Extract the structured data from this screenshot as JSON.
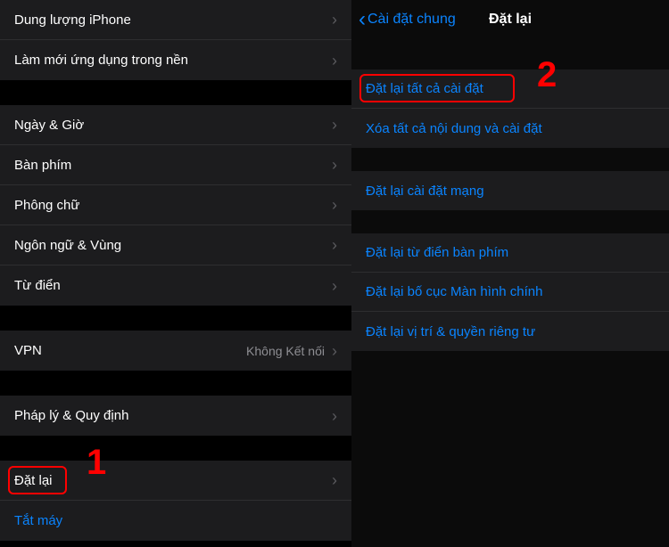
{
  "left": {
    "group1": [
      {
        "label": "Dung lượng iPhone"
      },
      {
        "label": "Làm mới ứng dụng trong nền"
      }
    ],
    "group2": [
      {
        "label": "Ngày & Giờ"
      },
      {
        "label": "Bàn phím"
      },
      {
        "label": "Phông chữ"
      },
      {
        "label": "Ngôn ngữ & Vùng"
      },
      {
        "label": "Từ điển"
      }
    ],
    "group3": [
      {
        "label": "VPN",
        "value": "Không Kết nối"
      }
    ],
    "group4": [
      {
        "label": "Pháp lý & Quy định"
      }
    ],
    "group5": [
      {
        "label": "Đặt lại"
      },
      {
        "label": "Tắt máy",
        "blue": true
      }
    ],
    "callout1": "1"
  },
  "right": {
    "back": "Cài đặt chung",
    "title": "Đặt lại",
    "group1": [
      {
        "label": "Đặt lại tất cả cài đặt"
      },
      {
        "label": "Xóa tất cả nội dung và cài đặt"
      }
    ],
    "group2": [
      {
        "label": "Đặt lại cài đặt mạng"
      }
    ],
    "group3": [
      {
        "label": "Đặt lại từ điển bàn phím"
      },
      {
        "label": "Đặt lại bố cục Màn hình chính"
      },
      {
        "label": "Đặt lại vị trí & quyền riêng tư"
      }
    ],
    "callout2": "2"
  }
}
